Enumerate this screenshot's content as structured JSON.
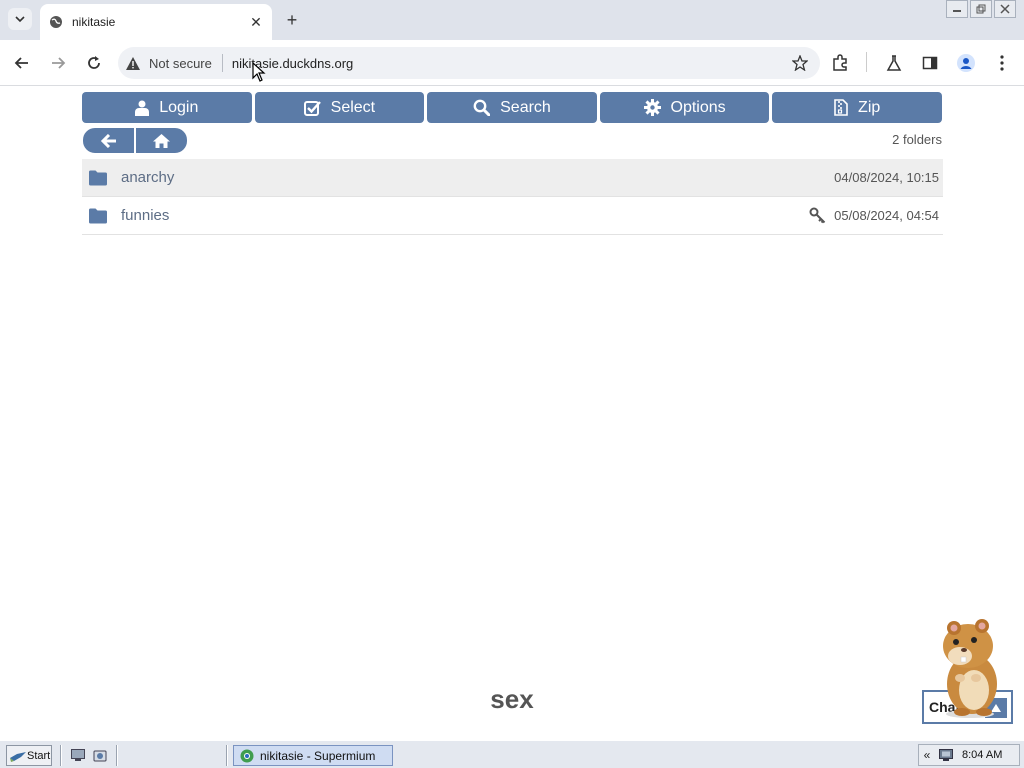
{
  "browser": {
    "tab_title": "nikitasie",
    "not_secure_label": "Not secure",
    "url": "nikitasie.duckdns.org"
  },
  "actions": [
    {
      "label": "Login",
      "icon": "user-icon"
    },
    {
      "label": "Select",
      "icon": "checkbox-icon"
    },
    {
      "label": "Search",
      "icon": "search-icon"
    },
    {
      "label": "Options",
      "icon": "gear-icon"
    },
    {
      "label": "Zip",
      "icon": "zip-file-icon"
    }
  ],
  "folder_count": "2 folders",
  "folders": [
    {
      "name": "anarchy",
      "date": "04/08/2024, 10:15",
      "locked": false
    },
    {
      "name": "funnies",
      "date": "05/08/2024, 04:54",
      "locked": true
    }
  ],
  "footer_text": "sex",
  "chat_label": "Chat",
  "taskbar": {
    "start_label": "Start",
    "task_label": "nikitasie - Supermium",
    "clock": "8:04 AM"
  },
  "colors": {
    "accent": "#5b7ba7",
    "tabstrip": "#dfe3eb"
  }
}
